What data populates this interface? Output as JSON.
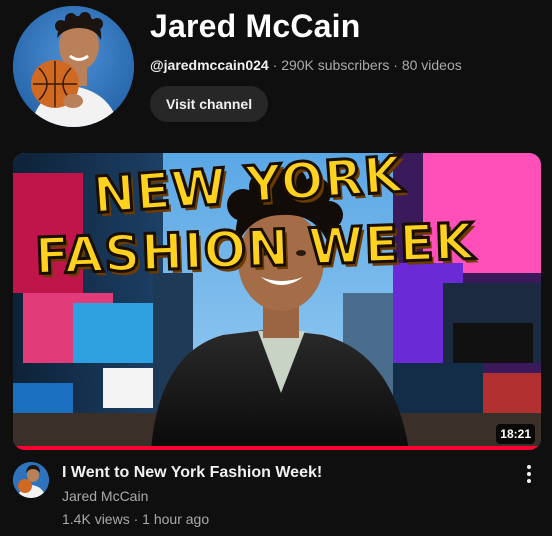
{
  "channel": {
    "name": "Jared McCain",
    "handle": "@jaredmccain024",
    "subscribers": "290K subscribers",
    "video_count": "80 videos",
    "separator": "·",
    "visit_label": "Visit channel"
  },
  "video": {
    "thumbnail_text_line1": "NEW YORK",
    "thumbnail_text_line2": "FASHION WEEK",
    "duration": "18:21",
    "watch_progress_percent": 100,
    "title": "I Went to New York Fashion Week!",
    "channel": "Jared McCain",
    "views": "1.4K views",
    "age": "1 hour ago",
    "stats_separator": "·"
  },
  "colors": {
    "background": "#0f0f0f",
    "progress": "#ff0033",
    "thumbnail_text": "#ffd21f",
    "button_bg": "#272727"
  },
  "icons": {
    "more": "more-vert-icon"
  }
}
